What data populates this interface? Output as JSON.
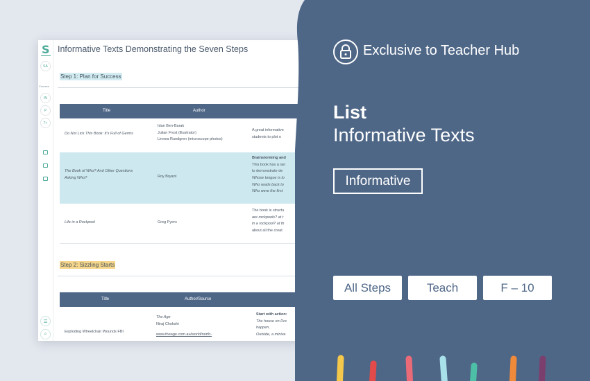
{
  "document": {
    "logo": "S",
    "title": "Informative Texts Demonstrating the Seven Steps",
    "rail": {
      "avatar": "SA",
      "courses_label": "Courses",
      "course_badges": [
        "IN",
        "P",
        "7+"
      ]
    },
    "step1": {
      "heading": "Step 1: Plan for Success",
      "columns": [
        "Title",
        "Author"
      ],
      "rows": [
        {
          "title": "Do Not Lick This Book: It's Full of Germs",
          "author_lines": [
            "Idan Ben-Barak",
            "Julian Frost (illustrator)",
            "Linnea Rundgren (microscope photos)"
          ],
          "desc_lines": [
            "A great informative",
            "students to plot o"
          ]
        },
        {
          "title_lines": [
            "The Book of Who? And Other Questions",
            "Asking Who?"
          ],
          "author": "Roy Bryant",
          "desc_heading": "Brainstorming and",
          "desc_lines": [
            "This book has a ran",
            "to demonstrate de"
          ],
          "desc_italic_lines": [
            "Whose tongue is lo",
            "Who reads back to",
            "Who were the first"
          ]
        },
        {
          "title": "Life in a Rockpool",
          "author": "Greg Pyers",
          "desc_lines": [
            "The book is structu",
            "are rockpools? at t",
            "in a rockpool? at th",
            "about all the creat"
          ]
        }
      ]
    },
    "step2": {
      "heading": "Step 2: Sizzling Starts",
      "columns": [
        "Title",
        "Author/Source"
      ],
      "rows": [
        {
          "title": "Exploding Wheelchair Wounds FBI",
          "source_lines": [
            "The Age",
            "Niraj Chokshi",
            "www.theage.com.au/world/north-"
          ],
          "desc_heading": "Start with action:",
          "desc_lines": [
            "The house on Dre",
            "happen.",
            "Outside, a miniva"
          ]
        }
      ]
    }
  },
  "panel": {
    "lock_icon": "lock-icon",
    "exclusive": "Exclusive to Teacher Hub",
    "list_label": "List",
    "list_title": "Informative Texts",
    "category_tag": "Informative",
    "tags": [
      "All Steps",
      "Teach",
      "F – 10"
    ],
    "colors": {
      "panel": "#4f6787",
      "accent": "#4daa9a"
    }
  }
}
